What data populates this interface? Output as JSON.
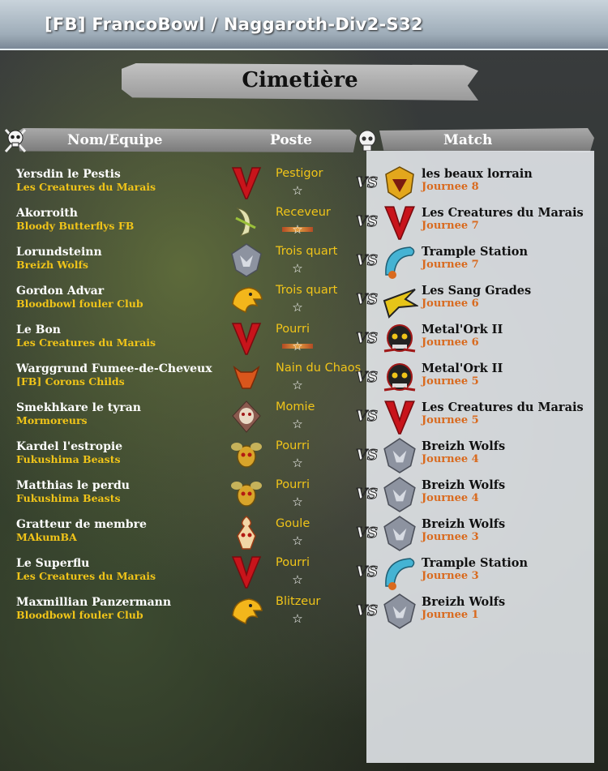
{
  "window": {
    "title": "[FB] FrancoBowl / Naggaroth-Div2-S32"
  },
  "page": {
    "title": "Cimetière"
  },
  "columns": {
    "name": "Nom/Equipe",
    "position": "Poste",
    "match": "Match"
  },
  "vs_label": "VS",
  "colors": {
    "team_text": "#f0c419",
    "day_text": "#d96a1e",
    "opponent_text": "#111111",
    "name_text": "#ffffff"
  },
  "rows": [
    {
      "name": "Yersdin le Pestis",
      "team": "Les Creatures du Marais",
      "team_icon": "red-v-emblem-icon",
      "position": "Pestigor",
      "badge": false,
      "opponent": "les beaux lorrain",
      "opponent_icon": "gold-crest-icon",
      "day": "Journee 8"
    },
    {
      "name": "Akorroith",
      "team": "Bloody Butterflys FB",
      "team_icon": "elf-moon-emblem-icon",
      "position": "Receveur",
      "badge": true,
      "opponent": "Les Creatures du Marais",
      "opponent_icon": "red-v-emblem-icon",
      "day": "Journee 7"
    },
    {
      "name": "Lorundsteinn",
      "team": "Breizh Wolfs",
      "team_icon": "wolf-shield-icon",
      "position": "Trois quart",
      "badge": false,
      "opponent": "Trample Station",
      "opponent_icon": "blue-horn-icon",
      "day": "Journee 7"
    },
    {
      "name": "Gordon Advar",
      "team": "Bloodbowl fouler Club",
      "team_icon": "eagle-head-icon",
      "position": "Trois quart",
      "badge": false,
      "opponent": "Les Sang Grades",
      "opponent_icon": "gold-claw-icon",
      "day": "Journee 6"
    },
    {
      "name": "Le Bon",
      "team": "Les Creatures du Marais",
      "team_icon": "red-v-emblem-icon",
      "position": "Pourri",
      "badge": true,
      "opponent": "Metal'Ork II",
      "opponent_icon": "ork-skull-icon",
      "day": "Journee 6"
    },
    {
      "name": "Warggrund Fumee-de-Cheveux",
      "team": "[FB] Corons Childs",
      "team_icon": "bull-head-icon",
      "position": "Nain du Chaos",
      "badge": false,
      "opponent": "Metal'Ork II",
      "opponent_icon": "ork-skull-icon",
      "day": "Journee 5"
    },
    {
      "name": "Smekhkare le tyran",
      "team": "Mormoreurs",
      "team_icon": "mummy-skull-icon",
      "position": "Momie",
      "badge": false,
      "opponent": "Les Creatures du Marais",
      "opponent_icon": "red-v-emblem-icon",
      "day": "Journee 5"
    },
    {
      "name": "Kardel l'estropie",
      "team": "Fukushima Beasts",
      "team_icon": "nurgle-fly-icon",
      "position": "Pourri",
      "badge": false,
      "opponent": "Breizh Wolfs",
      "opponent_icon": "wolf-shield-icon",
      "day": "Journee 4"
    },
    {
      "name": "Matthias le perdu",
      "team": "Fukushima Beasts",
      "team_icon": "nurgle-fly-icon",
      "position": "Pourri",
      "badge": false,
      "opponent": "Breizh Wolfs",
      "opponent_icon": "wolf-shield-icon",
      "day": "Journee 4"
    },
    {
      "name": "Gratteur de membre",
      "team": "MAkumBA",
      "team_icon": "ghoul-skull-icon",
      "position": "Goule",
      "badge": false,
      "opponent": "Breizh Wolfs",
      "opponent_icon": "wolf-shield-icon",
      "day": "Journee 3"
    },
    {
      "name": "Le Superflu",
      "team": "Les Creatures du Marais",
      "team_icon": "red-v-emblem-icon",
      "position": "Pourri",
      "badge": false,
      "opponent": "Trample Station",
      "opponent_icon": "blue-horn-icon",
      "day": "Journee 3"
    },
    {
      "name": "Maxmillian Panzermann",
      "team": "Bloodbowl fouler Club",
      "team_icon": "eagle-head-icon",
      "position": "Blitzeur",
      "badge": false,
      "opponent": "Breizh Wolfs",
      "opponent_icon": "wolf-shield-icon",
      "day": "Journee 1"
    }
  ]
}
